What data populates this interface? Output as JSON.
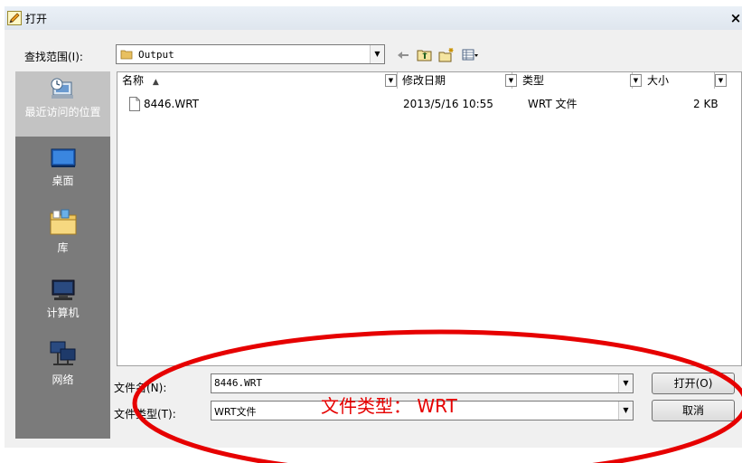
{
  "window": {
    "title": "打开",
    "close_label": "×"
  },
  "look_in": {
    "label": "查找范围(I):",
    "value": "Output"
  },
  "places": [
    {
      "label": "最近访问的位置",
      "icon": "recent-places-icon"
    },
    {
      "label": "桌面",
      "icon": "desktop-icon"
    },
    {
      "label": "库",
      "icon": "libraries-icon"
    },
    {
      "label": "计算机",
      "icon": "computer-icon"
    },
    {
      "label": "网络",
      "icon": "network-icon"
    }
  ],
  "columns": {
    "name": "名称",
    "date": "修改日期",
    "type": "类型",
    "size": "大小"
  },
  "files": [
    {
      "name": "8446.WRT",
      "date": "2013/5/16 10:55",
      "type": "WRT 文件",
      "size": "2 KB"
    }
  ],
  "filename": {
    "label": "文件名(N):",
    "value": "8446.WRT"
  },
  "filetype": {
    "label": "文件类型(T):",
    "value": "WRT文件"
  },
  "buttons": {
    "open": "打开(O)",
    "cancel": "取消"
  },
  "annotation": {
    "text": "文件类型：  WRT",
    "color": "#e60000"
  }
}
